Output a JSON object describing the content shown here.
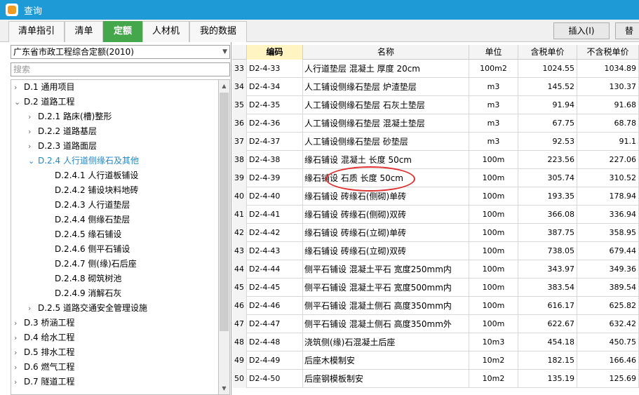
{
  "window": {
    "title": "查询"
  },
  "tabs": [
    {
      "label": "清单指引",
      "active": false
    },
    {
      "label": "清单",
      "active": false
    },
    {
      "label": "定额",
      "active": true
    },
    {
      "label": "人材机",
      "active": false
    },
    {
      "label": "我的数据",
      "active": false
    }
  ],
  "buttons": {
    "insert": "插入(I)",
    "replace": "替"
  },
  "left": {
    "dropdown_value": "广东省市政工程综合定额(2010)",
    "search_placeholder": "搜索",
    "tree": [
      {
        "toggle": "›",
        "label": "D.1 通用项目",
        "level": 0
      },
      {
        "toggle": "⌄",
        "label": "D.2 道路工程",
        "level": 0
      },
      {
        "toggle": "›",
        "label": "D.2.1 路床(槽)整形",
        "level": 1
      },
      {
        "toggle": "›",
        "label": "D.2.2 道路基层",
        "level": 1
      },
      {
        "toggle": "›",
        "label": "D.2.3 道路面层",
        "level": 1
      },
      {
        "toggle": "⌄",
        "label": "D.2.4 人行道侧缘石及其他",
        "level": 1,
        "selected": true
      },
      {
        "toggle": "",
        "label": "D.2.4.1 人行道板铺设",
        "level": 2
      },
      {
        "toggle": "",
        "label": "D.2.4.2 铺设块料地砖",
        "level": 2
      },
      {
        "toggle": "",
        "label": "D.2.4.3 人行道垫层",
        "level": 2
      },
      {
        "toggle": "",
        "label": "D.2.4.4 侧缘石垫层",
        "level": 2
      },
      {
        "toggle": "",
        "label": "D.2.4.5 缘石铺设",
        "level": 2
      },
      {
        "toggle": "",
        "label": "D.2.4.6 侧平石铺设",
        "level": 2
      },
      {
        "toggle": "",
        "label": "D.2.4.7 侧(缘)石后座",
        "level": 2
      },
      {
        "toggle": "",
        "label": "D.2.4.8 砌筑树池",
        "level": 2
      },
      {
        "toggle": "",
        "label": "D.2.4.9 消解石灰",
        "level": 2
      },
      {
        "toggle": "›",
        "label": "D.2.5 道路交通安全管理设施",
        "level": 1
      },
      {
        "toggle": "›",
        "label": "D.3 桥涵工程",
        "level": 0
      },
      {
        "toggle": "›",
        "label": "D.4 给水工程",
        "level": 0
      },
      {
        "toggle": "›",
        "label": "D.5 排水工程",
        "level": 0
      },
      {
        "toggle": "›",
        "label": "D.6 燃气工程",
        "level": 0
      },
      {
        "toggle": "›",
        "label": "D.7 隧道工程",
        "level": 0
      }
    ]
  },
  "table": {
    "headers": {
      "num": "",
      "code": "编码",
      "name": "名称",
      "unit": "单位",
      "tax": "含税单价",
      "notax": "不含税单价"
    },
    "rows": [
      {
        "num": "33",
        "code": "D2-4-33",
        "name": "人行道垫层 混凝土 厚度 20cm",
        "unit": "100m2",
        "tax": "1024.55",
        "notax": "1034.89"
      },
      {
        "num": "34",
        "code": "D2-4-34",
        "name": "人工铺设侧缘石垫层 炉渣垫层",
        "unit": "m3",
        "tax": "145.52",
        "notax": "130.37"
      },
      {
        "num": "35",
        "code": "D2-4-35",
        "name": "人工铺设侧缘石垫层 石灰土垫层",
        "unit": "m3",
        "tax": "91.94",
        "notax": "91.68"
      },
      {
        "num": "36",
        "code": "D2-4-36",
        "name": "人工铺设侧缘石垫层 混凝土垫层",
        "unit": "m3",
        "tax": "67.75",
        "notax": "68.78"
      },
      {
        "num": "37",
        "code": "D2-4-37",
        "name": "人工铺设侧缘石垫层 砂垫层",
        "unit": "m3",
        "tax": "92.53",
        "notax": "91.1"
      },
      {
        "num": "38",
        "code": "D2-4-38",
        "name": "缘石铺设 混凝土 长度 50cm",
        "unit": "100m",
        "tax": "223.56",
        "notax": "227.06"
      },
      {
        "num": "39",
        "code": "D2-4-39",
        "name": "缘石铺设 石质 长度 50cm",
        "unit": "100m",
        "tax": "305.74",
        "notax": "310.52"
      },
      {
        "num": "40",
        "code": "D2-4-40",
        "name": "缘石铺设 砖缘石(侧砌)单砖",
        "unit": "100m",
        "tax": "193.35",
        "notax": "178.94"
      },
      {
        "num": "41",
        "code": "D2-4-41",
        "name": "缘石铺设 砖缘石(侧砌)双砖",
        "unit": "100m",
        "tax": "366.08",
        "notax": "336.94"
      },
      {
        "num": "42",
        "code": "D2-4-42",
        "name": "缘石铺设 砖缘石(立砌)单砖",
        "unit": "100m",
        "tax": "387.75",
        "notax": "358.95"
      },
      {
        "num": "43",
        "code": "D2-4-43",
        "name": "缘石铺设 砖缘石(立砌)双砖",
        "unit": "100m",
        "tax": "738.05",
        "notax": "679.44"
      },
      {
        "num": "44",
        "code": "D2-4-44",
        "name": "侧平石铺设 混凝土平石 宽度250mm内",
        "unit": "100m",
        "tax": "343.97",
        "notax": "349.36"
      },
      {
        "num": "45",
        "code": "D2-4-45",
        "name": "侧平石铺设 混凝土平石 宽度500mm内",
        "unit": "100m",
        "tax": "383.54",
        "notax": "389.54"
      },
      {
        "num": "46",
        "code": "D2-4-46",
        "name": "侧平石铺设 混凝土侧石 高度350mm内",
        "unit": "100m",
        "tax": "616.17",
        "notax": "625.82"
      },
      {
        "num": "47",
        "code": "D2-4-47",
        "name": "侧平石铺设 混凝土侧石 高度350mm外",
        "unit": "100m",
        "tax": "622.67",
        "notax": "632.42"
      },
      {
        "num": "48",
        "code": "D2-4-48",
        "name": "浇筑侧(缘)石混凝土后座",
        "unit": "10m3",
        "tax": "454.18",
        "notax": "450.75"
      },
      {
        "num": "49",
        "code": "D2-4-49",
        "name": "后座木模制安",
        "unit": "10m2",
        "tax": "182.15",
        "notax": "166.46"
      },
      {
        "num": "50",
        "code": "D2-4-50",
        "name": "后座钢模板制安",
        "unit": "10m2",
        "tax": "135.19",
        "notax": "125.69"
      }
    ]
  }
}
